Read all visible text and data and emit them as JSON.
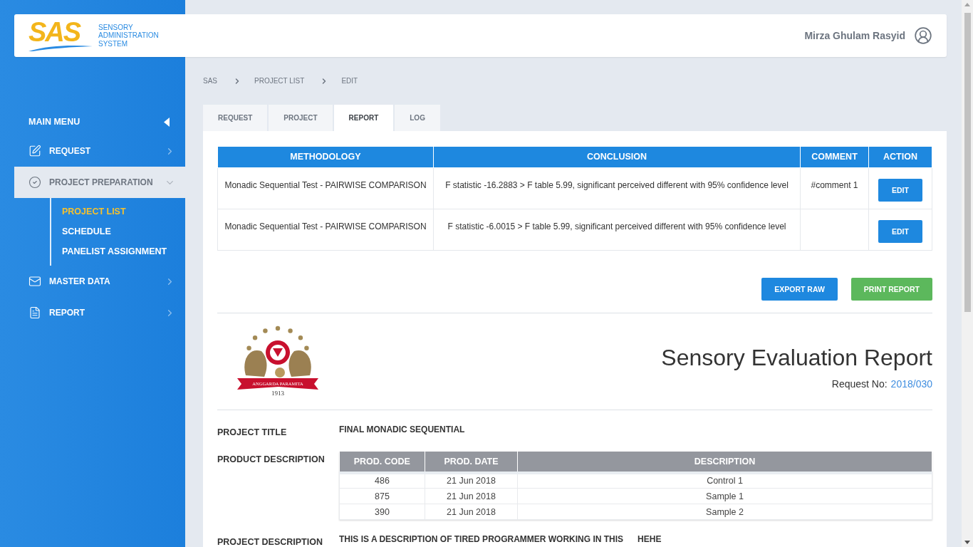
{
  "header": {
    "logo_letters": "SAS",
    "logo_caption": [
      "SENSORY",
      "ADMINISTRATION",
      "SYSTEM"
    ],
    "user_name": "Mirza Ghulam Rasyid"
  },
  "sidebar": {
    "title": "MAIN MENU",
    "items": [
      {
        "label": "REQUEST",
        "kind": "edit",
        "selected": false,
        "expanded": false
      },
      {
        "label": "PROJECT PREPARATION",
        "kind": "check",
        "selected": true,
        "expanded": true,
        "children": [
          {
            "label": "PROJECT LIST",
            "selected": true
          },
          {
            "label": "SCHEDULE",
            "selected": false
          },
          {
            "label": "PANELIST ASSIGNMENT",
            "selected": false
          }
        ]
      },
      {
        "label": "MASTER DATA",
        "kind": "inbox",
        "selected": false,
        "expanded": false
      },
      {
        "label": "REPORT",
        "kind": "document",
        "selected": false,
        "expanded": false
      }
    ]
  },
  "breadcrumb": [
    "SAS",
    "PROJECT LIST",
    "EDIT"
  ],
  "tabs": [
    {
      "label": "REQUEST",
      "selected": false
    },
    {
      "label": "PROJECT",
      "selected": false
    },
    {
      "label": "REPORT",
      "selected": true
    },
    {
      "label": "LOG",
      "selected": false
    }
  ],
  "results_table": {
    "columns": [
      "METHODOLOGY",
      "CONCLUSION",
      "COMMENT",
      "ACTION"
    ],
    "rows": [
      {
        "methodology": "Monadic Sequential Test - PAIRWISE COMPARISON",
        "conclusion": "F statistic -16.2883 > F table 5.99, significant perceived different with 95% confidence level",
        "comment": "#comment 1",
        "action": "EDIT"
      },
      {
        "methodology": "Monadic Sequential Test - PAIRWISE COMPARISON",
        "conclusion": "F statistic -6.0015 > F table 5.99, significant perceived different with 95% confidence level",
        "action": "EDIT"
      }
    ]
  },
  "buttons": [
    {
      "label": "EXPORT RAW",
      "kind": "primary"
    },
    {
      "label": "PRINT REPORT",
      "kind": "success"
    }
  ],
  "report": {
    "emblem": {
      "motto": "ANGGARDA PARAMITA",
      "year": "1913"
    },
    "title": "Sensory Evaluation Report",
    "request_label": "Request No:",
    "request_no": "2018/030",
    "fields": [
      {
        "kind": "text",
        "label": "PROJECT TITLE",
        "value": "FINAL MONADIC SEQUENTIAL"
      },
      {
        "kind": "table",
        "label": "PRODUCT DESCRIPTION",
        "columns": [
          "PROD. CODE",
          "PROD. DATE",
          "DESCRIPTION"
        ],
        "rows": [
          [
            "486",
            "21 Jun 2018",
            "Control 1"
          ],
          [
            "875",
            "21 Jun 2018",
            "Sample 1"
          ],
          [
            "390",
            "21 Jun 2018",
            "Sample 2"
          ]
        ]
      },
      {
        "kind": "text",
        "label": "PROJECT DESCRIPTION",
        "value": "THIS IS A DESCRIPTION OF TIRED PROGRAMMER WORKING IN THIS      HEHE"
      }
    ]
  }
}
